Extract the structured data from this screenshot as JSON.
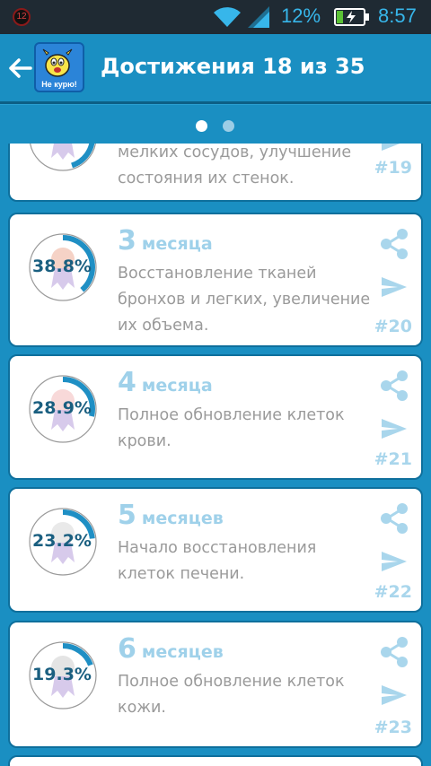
{
  "status_bar": {
    "notification_count": "12",
    "battery_percent": "12%",
    "time": "8:57",
    "accent_color": "#37b6ea"
  },
  "app_bar": {
    "title": "Достижения 18 из 35",
    "logo_text": "Не курю!",
    "back_icon": "arrow-left-icon"
  },
  "pager": {
    "pages": 2,
    "active_index": 0
  },
  "achievements": [
    {
      "number": "#19",
      "period_num": "",
      "period_unit": "",
      "percent": "",
      "progress": 0.45,
      "description": "мелких сосудов, улучшение состояния их стенок."
    },
    {
      "number": "#20",
      "period_num": "3",
      "period_unit": "месяца",
      "percent": "38.8%",
      "progress": 0.388,
      "description": "Восстановление тканей бронхов и легких, увеличение их объема."
    },
    {
      "number": "#21",
      "period_num": "4",
      "period_unit": "месяца",
      "percent": "28.9%",
      "progress": 0.289,
      "description": "Полное обновление клеток крови."
    },
    {
      "number": "#22",
      "period_num": "5",
      "period_unit": "месяцев",
      "percent": "23.2%",
      "progress": 0.232,
      "description": "Начало восстановления клеток печени."
    },
    {
      "number": "#23",
      "period_num": "6",
      "period_unit": "месяцев",
      "percent": "19.3%",
      "progress": 0.193,
      "description": "Полное обновление клеток кожи."
    }
  ]
}
